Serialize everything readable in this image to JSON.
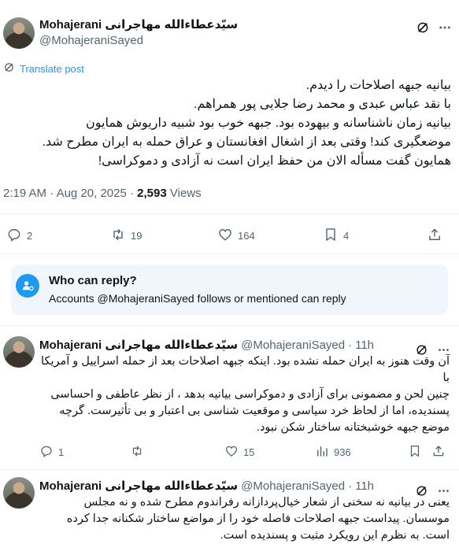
{
  "main_tweet": {
    "name": "Mohajerani سیّدعطاءالله مهاجرانی",
    "handle": "@MohajeraniSayed",
    "translate_label": "Translate post",
    "body_lines": [
      "بیانیه جبهه اصلاحات را دیدم.",
      "با نقد عباس عبدی و محمد رضا جلایی پور همراهم.",
      "بیانیه زمان ناشناسانه و بیهوده بود. جبهه خوب بود شبیه داریوش همایون",
      "موضعگیری کند! وقتی بعد از اشغال افغانستان و عراق حمله به ایران  مطرح شد.",
      "همایون گفت مسأله الان من حفظ ایران است نه آزادی و دموکراسی!"
    ],
    "time": "2:19 AM",
    "date": "Aug 20, 2025",
    "views_count": "2,593",
    "views_label": "Views",
    "replies": "2",
    "reposts": "19",
    "likes": "164",
    "bookmarks": "4"
  },
  "who_can_reply": {
    "title": "Who can reply?",
    "description": "Accounts @MohajeraniSayed follows or mentioned can reply"
  },
  "replies": [
    {
      "name": "Mohajerani سیّدعطاءالله مهاجرانی",
      "handle": "@MohajeraniSayed",
      "time": "11h",
      "body_lines": [
        "آن وقت هنوز به ایران حمله نشده بود. اینکه جبهه اصلاحات بعد از حمله اسراییل و آمریکا",
        "با",
        "چنین لحن و مضمونی  برای آزادی و دموکراسی بیانیه بدهد ، از نظر عاطفی و احساسی",
        "پسندیده، اما از لحاظ خرد سیاسی و موقعیت شناسی بی اعتبار و بی تأثیرست. گرچه",
        "موضع جبهه خوشبختانه ساختار شکن نبود."
      ],
      "replies": "1",
      "reposts": "",
      "likes": "15",
      "views": "936"
    },
    {
      "name": "Mohajerani سیّدعطاءالله مهاجرانی",
      "handle": "@MohajeraniSayed",
      "time": "11h",
      "body_lines": [
        "یعنی در بیانیه نه سخنی از شعار خیال‌پردازانه رفراندوم مطرح شده و نه مجلس",
        "موسسان. پیداست جبهه اصلاحات فاصله خود را از مواضع ساختار شکنانه جدا کرده",
        "است.  به نظرم این رویکرد مثبت و پسندیده است."
      ]
    }
  ],
  "icons": {
    "grok": "grok-icon",
    "more": "more-icon",
    "translate": "translate-icon",
    "reply": "reply-icon",
    "repost": "repost-icon",
    "like": "like-icon",
    "bookmark": "bookmark-icon",
    "share": "share-icon",
    "views": "views-icon",
    "who_can_reply": "at-person-icon"
  },
  "colors": {
    "accent": "#1d9bf0",
    "secondary_text": "#536471",
    "info_background": "#f0f6fb"
  }
}
